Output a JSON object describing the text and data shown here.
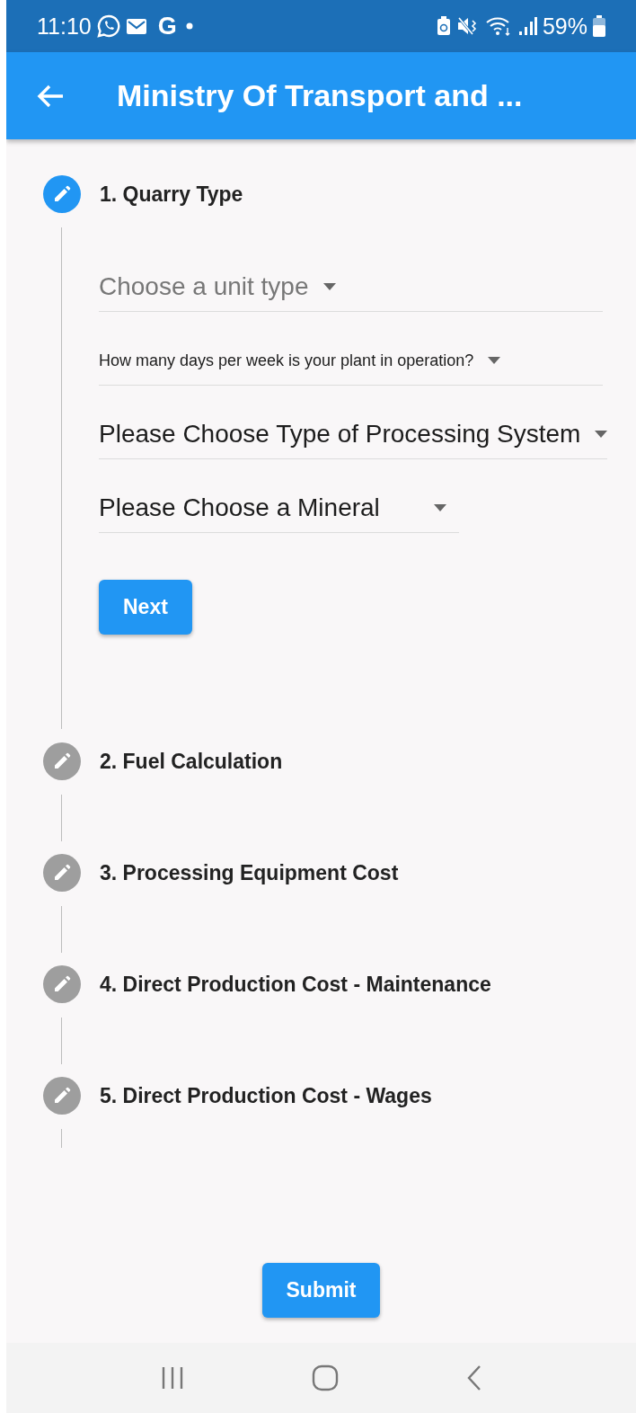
{
  "status_bar": {
    "time": "11:10",
    "app_glyph": "G",
    "battery": "59%"
  },
  "app_bar": {
    "title": "Ministry Of Transport and ..."
  },
  "steps": [
    {
      "title": "1. Quarry Type",
      "active": true,
      "button": "Next",
      "fields": [
        {
          "kind": "large",
          "text": "Choose a unit type",
          "muted": true
        },
        {
          "kind": "small",
          "text": "How many days per week is your plant in operation?",
          "muted": false
        },
        {
          "kind": "large",
          "text": "Please Choose Type of Processing System",
          "muted": false
        },
        {
          "kind": "short",
          "text": "Please Choose a Mineral",
          "muted": false
        }
      ]
    },
    {
      "title": "2. Fuel Calculation",
      "active": false
    },
    {
      "title": "3. Processing Equipment Cost",
      "active": false
    },
    {
      "title": "4. Direct Production Cost - Maintenance",
      "active": false
    },
    {
      "title": "5. Direct Production Cost - Wages",
      "active": false
    }
  ],
  "submit_button": "Submit"
}
